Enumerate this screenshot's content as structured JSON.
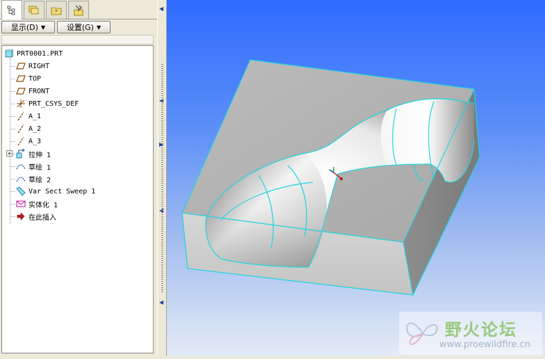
{
  "tabs": [
    {
      "name": "model-tree-tab",
      "icon": "tree-icon",
      "active": true
    },
    {
      "name": "folder-browser-tab",
      "icon": "folders-icon",
      "active": false
    },
    {
      "name": "favorites-tab",
      "icon": "star-folder-icon",
      "active": false
    },
    {
      "name": "connections-tab",
      "icon": "tools-icon",
      "active": false
    }
  ],
  "toolbar": {
    "display_label": "显示(D)",
    "settings_label": "设置(G)"
  },
  "tree": {
    "root": "PRT0001.PRT",
    "items": [
      {
        "label": "RIGHT",
        "icon": "datum-plane-icon"
      },
      {
        "label": "TOP",
        "icon": "datum-plane-icon"
      },
      {
        "label": "FRONT",
        "icon": "datum-plane-icon"
      },
      {
        "label": "PRT_CSYS_DEF",
        "icon": "csys-icon"
      },
      {
        "label": "A_1",
        "icon": "datum-axis-icon"
      },
      {
        "label": "A_2",
        "icon": "datum-axis-icon"
      },
      {
        "label": "A_3",
        "icon": "datum-axis-icon"
      },
      {
        "label": "拉伸 1",
        "icon": "extrude-icon"
      },
      {
        "label": "草绘 1",
        "icon": "sketch-icon"
      },
      {
        "label": "草绘 2",
        "icon": "sketch-icon"
      },
      {
        "label": "Var Sect Sweep 1",
        "icon": "sweep-icon"
      },
      {
        "label": "实体化 1",
        "icon": "solidify-icon"
      },
      {
        "label": "在此插入",
        "icon": "insert-here-icon"
      }
    ]
  },
  "watermark": {
    "title": "野火论坛",
    "url": "www.proewildfire.cn"
  },
  "colors": {
    "viewport_top": "#2f6bff",
    "viewport_bottom": "#e6ecf6",
    "edge_highlight": "#20d4e0",
    "model_gray": "#b4b4b4"
  }
}
